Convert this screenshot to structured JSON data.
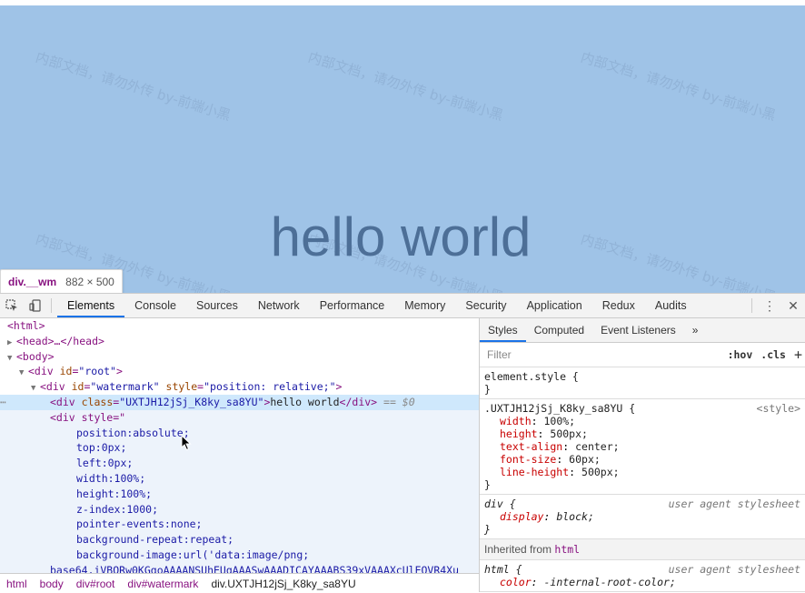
{
  "preview": {
    "hello_text": "hello world",
    "watermark_text": "内部文档，请勿外传 by-前端小黑",
    "background": "#9fc3e7"
  },
  "tooltip": {
    "tag": "div.__wm",
    "dims": "882 × 500"
  },
  "toolbar": {
    "tabs": [
      "Elements",
      "Console",
      "Sources",
      "Network",
      "Performance",
      "Memory",
      "Security",
      "Application",
      "Redux",
      "Audits"
    ],
    "active_tab": "Elements"
  },
  "dom": {
    "html_open": "<html>",
    "head": "<head>…</head>",
    "body_open": "<body>",
    "root_tag": "<div ",
    "root_attr": "id",
    "root_val": "\"root\"",
    "wm_tag": "<div ",
    "wm_attr1": "id",
    "wm_val1": "\"watermark\"",
    "wm_attr2": "style",
    "wm_val2": "\"position: relative;\"",
    "sel_tag": "<div ",
    "sel_attr": "class",
    "sel_val": "\"UXTJH12jSj_K8ky_sa8YU\"",
    "sel_text": "hello world",
    "sel_close": "</div>",
    "sel_marker": "== $0",
    "style_div": "<div style=\"",
    "css_lines": [
      "position:absolute;",
      "top:0px;",
      "left:0px;",
      "width:100%;",
      "height:100%;",
      "z-index:1000;",
      "pointer-events:none;",
      "background-repeat:repeat;",
      "background-image:url('data:image/png;"
    ],
    "base64_line": "base64,iVBORw0KGgoAAAANSUhEUgAAASwAAADICAYAAABS39xVAAAXcUlEQVR4Xu"
  },
  "breadcrumbs": [
    "html",
    "body",
    "div#root",
    "div#watermark",
    "div.UXTJH12jSj_K8ky_sa8YU"
  ],
  "styles_panel": {
    "tabs": [
      "Styles",
      "Computed",
      "Event Listeners"
    ],
    "more": "»",
    "filter_placeholder": "Filter",
    "hov": ":hov",
    "cls": ".cls",
    "plus": "+",
    "element_style": "element.style {",
    "close_brace": "}",
    "rule1_selector": ".UXTJH12jSj_K8ky_sa8YU {",
    "rule1_source": "<style>",
    "rule1_props": [
      {
        "name": "width",
        "value": "100%;"
      },
      {
        "name": "height",
        "value": "500px;"
      },
      {
        "name": "text-align",
        "value": "center;"
      },
      {
        "name": "font-size",
        "value": "60px;"
      },
      {
        "name": "line-height",
        "value": "500px;"
      }
    ],
    "rule2_selector": "div {",
    "rule2_source": "user agent stylesheet",
    "rule2_prop_name": "display",
    "rule2_prop_value": "block;",
    "inherited_label": "Inherited from",
    "inherited_tag": "html",
    "rule3_selector": "html {",
    "rule3_source": "user agent stylesheet",
    "rule3_prop_name": "color",
    "rule3_prop_value": "-internal-root-color;"
  }
}
